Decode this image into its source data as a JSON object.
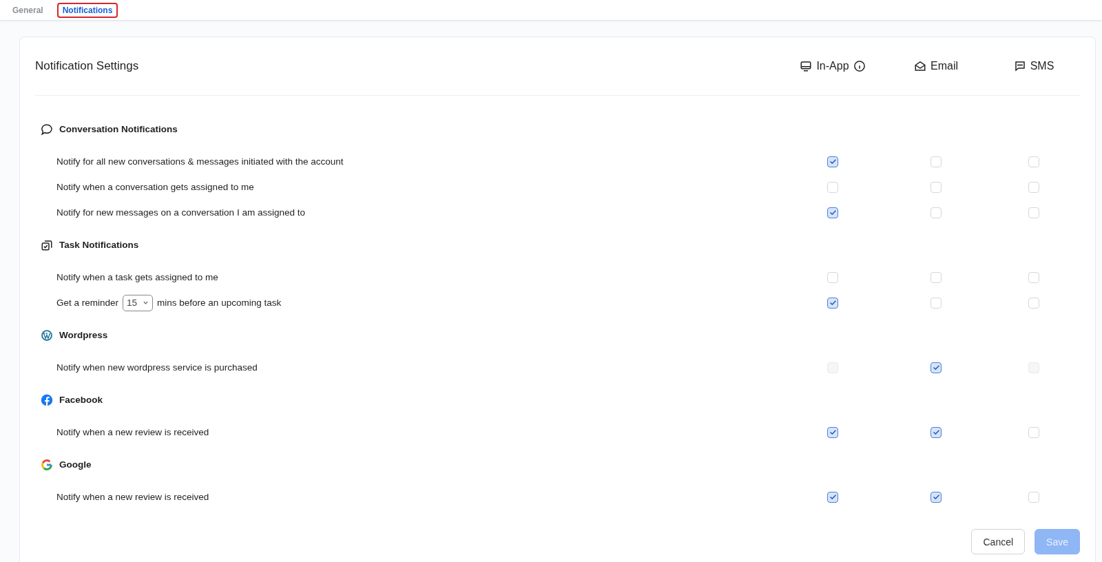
{
  "tabs": [
    {
      "label": "General",
      "selected": false,
      "highlighted": false
    },
    {
      "label": "Notifications",
      "selected": true,
      "highlighted": true
    }
  ],
  "title": "Notification Settings",
  "channels": [
    {
      "kind": "in_app",
      "label": "In-App",
      "info": true
    },
    {
      "kind": "email",
      "label": "Email",
      "info": false
    },
    {
      "kind": "sms",
      "label": "SMS",
      "info": false
    }
  ],
  "sections": [
    {
      "kind": "conversation",
      "title": "Conversation Notifications",
      "rows": [
        {
          "kind": "text",
          "label": "Notify for all new conversations & messages initiated with the account",
          "checks": [
            {
              "checked": true,
              "disabled": false
            },
            {
              "checked": false,
              "disabled": false
            },
            {
              "checked": false,
              "disabled": false
            }
          ]
        },
        {
          "kind": "text",
          "label": "Notify when a conversation gets assigned to me",
          "checks": [
            {
              "checked": false,
              "disabled": false
            },
            {
              "checked": false,
              "disabled": false
            },
            {
              "checked": false,
              "disabled": false
            }
          ]
        },
        {
          "kind": "text",
          "label": "Notify for new messages on a conversation I am assigned to",
          "checks": [
            {
              "checked": true,
              "disabled": false
            },
            {
              "checked": false,
              "disabled": false
            },
            {
              "checked": false,
              "disabled": false
            }
          ]
        }
      ]
    },
    {
      "kind": "task",
      "title": "Task Notifications",
      "rows": [
        {
          "kind": "text",
          "label": "Notify when a task gets assigned to me",
          "checks": [
            {
              "checked": false,
              "disabled": false
            },
            {
              "checked": false,
              "disabled": false
            },
            {
              "checked": false,
              "disabled": false
            }
          ]
        },
        {
          "kind": "reminder",
          "label": "Get a reminder",
          "select": "15",
          "label_after": "mins before an upcoming task",
          "checks": [
            {
              "checked": true,
              "disabled": false
            },
            {
              "checked": false,
              "disabled": false
            },
            {
              "checked": false,
              "disabled": false
            }
          ]
        }
      ]
    },
    {
      "kind": "wordpress",
      "title": "Wordpress",
      "rows": [
        {
          "kind": "text",
          "label": "Notify when new wordpress service is purchased",
          "checks": [
            {
              "checked": false,
              "disabled": true
            },
            {
              "checked": true,
              "disabled": false
            },
            {
              "checked": false,
              "disabled": true
            }
          ]
        }
      ]
    },
    {
      "kind": "facebook",
      "title": "Facebook",
      "rows": [
        {
          "kind": "text",
          "label": "Notify when a new review is received",
          "checks": [
            {
              "checked": true,
              "disabled": false
            },
            {
              "checked": true,
              "disabled": false
            },
            {
              "checked": false,
              "disabled": false
            }
          ]
        }
      ]
    },
    {
      "kind": "google",
      "title": "Google",
      "rows": [
        {
          "kind": "text",
          "label": "Notify when a new review is received",
          "checks": [
            {
              "checked": true,
              "disabled": false
            },
            {
              "checked": true,
              "disabled": false
            },
            {
              "checked": false,
              "disabled": false
            }
          ]
        }
      ]
    }
  ],
  "buttons": [
    {
      "kind": "secondary",
      "label": "Cancel",
      "disabled": false
    },
    {
      "kind": "primary",
      "label": "Save",
      "disabled": true
    }
  ]
}
